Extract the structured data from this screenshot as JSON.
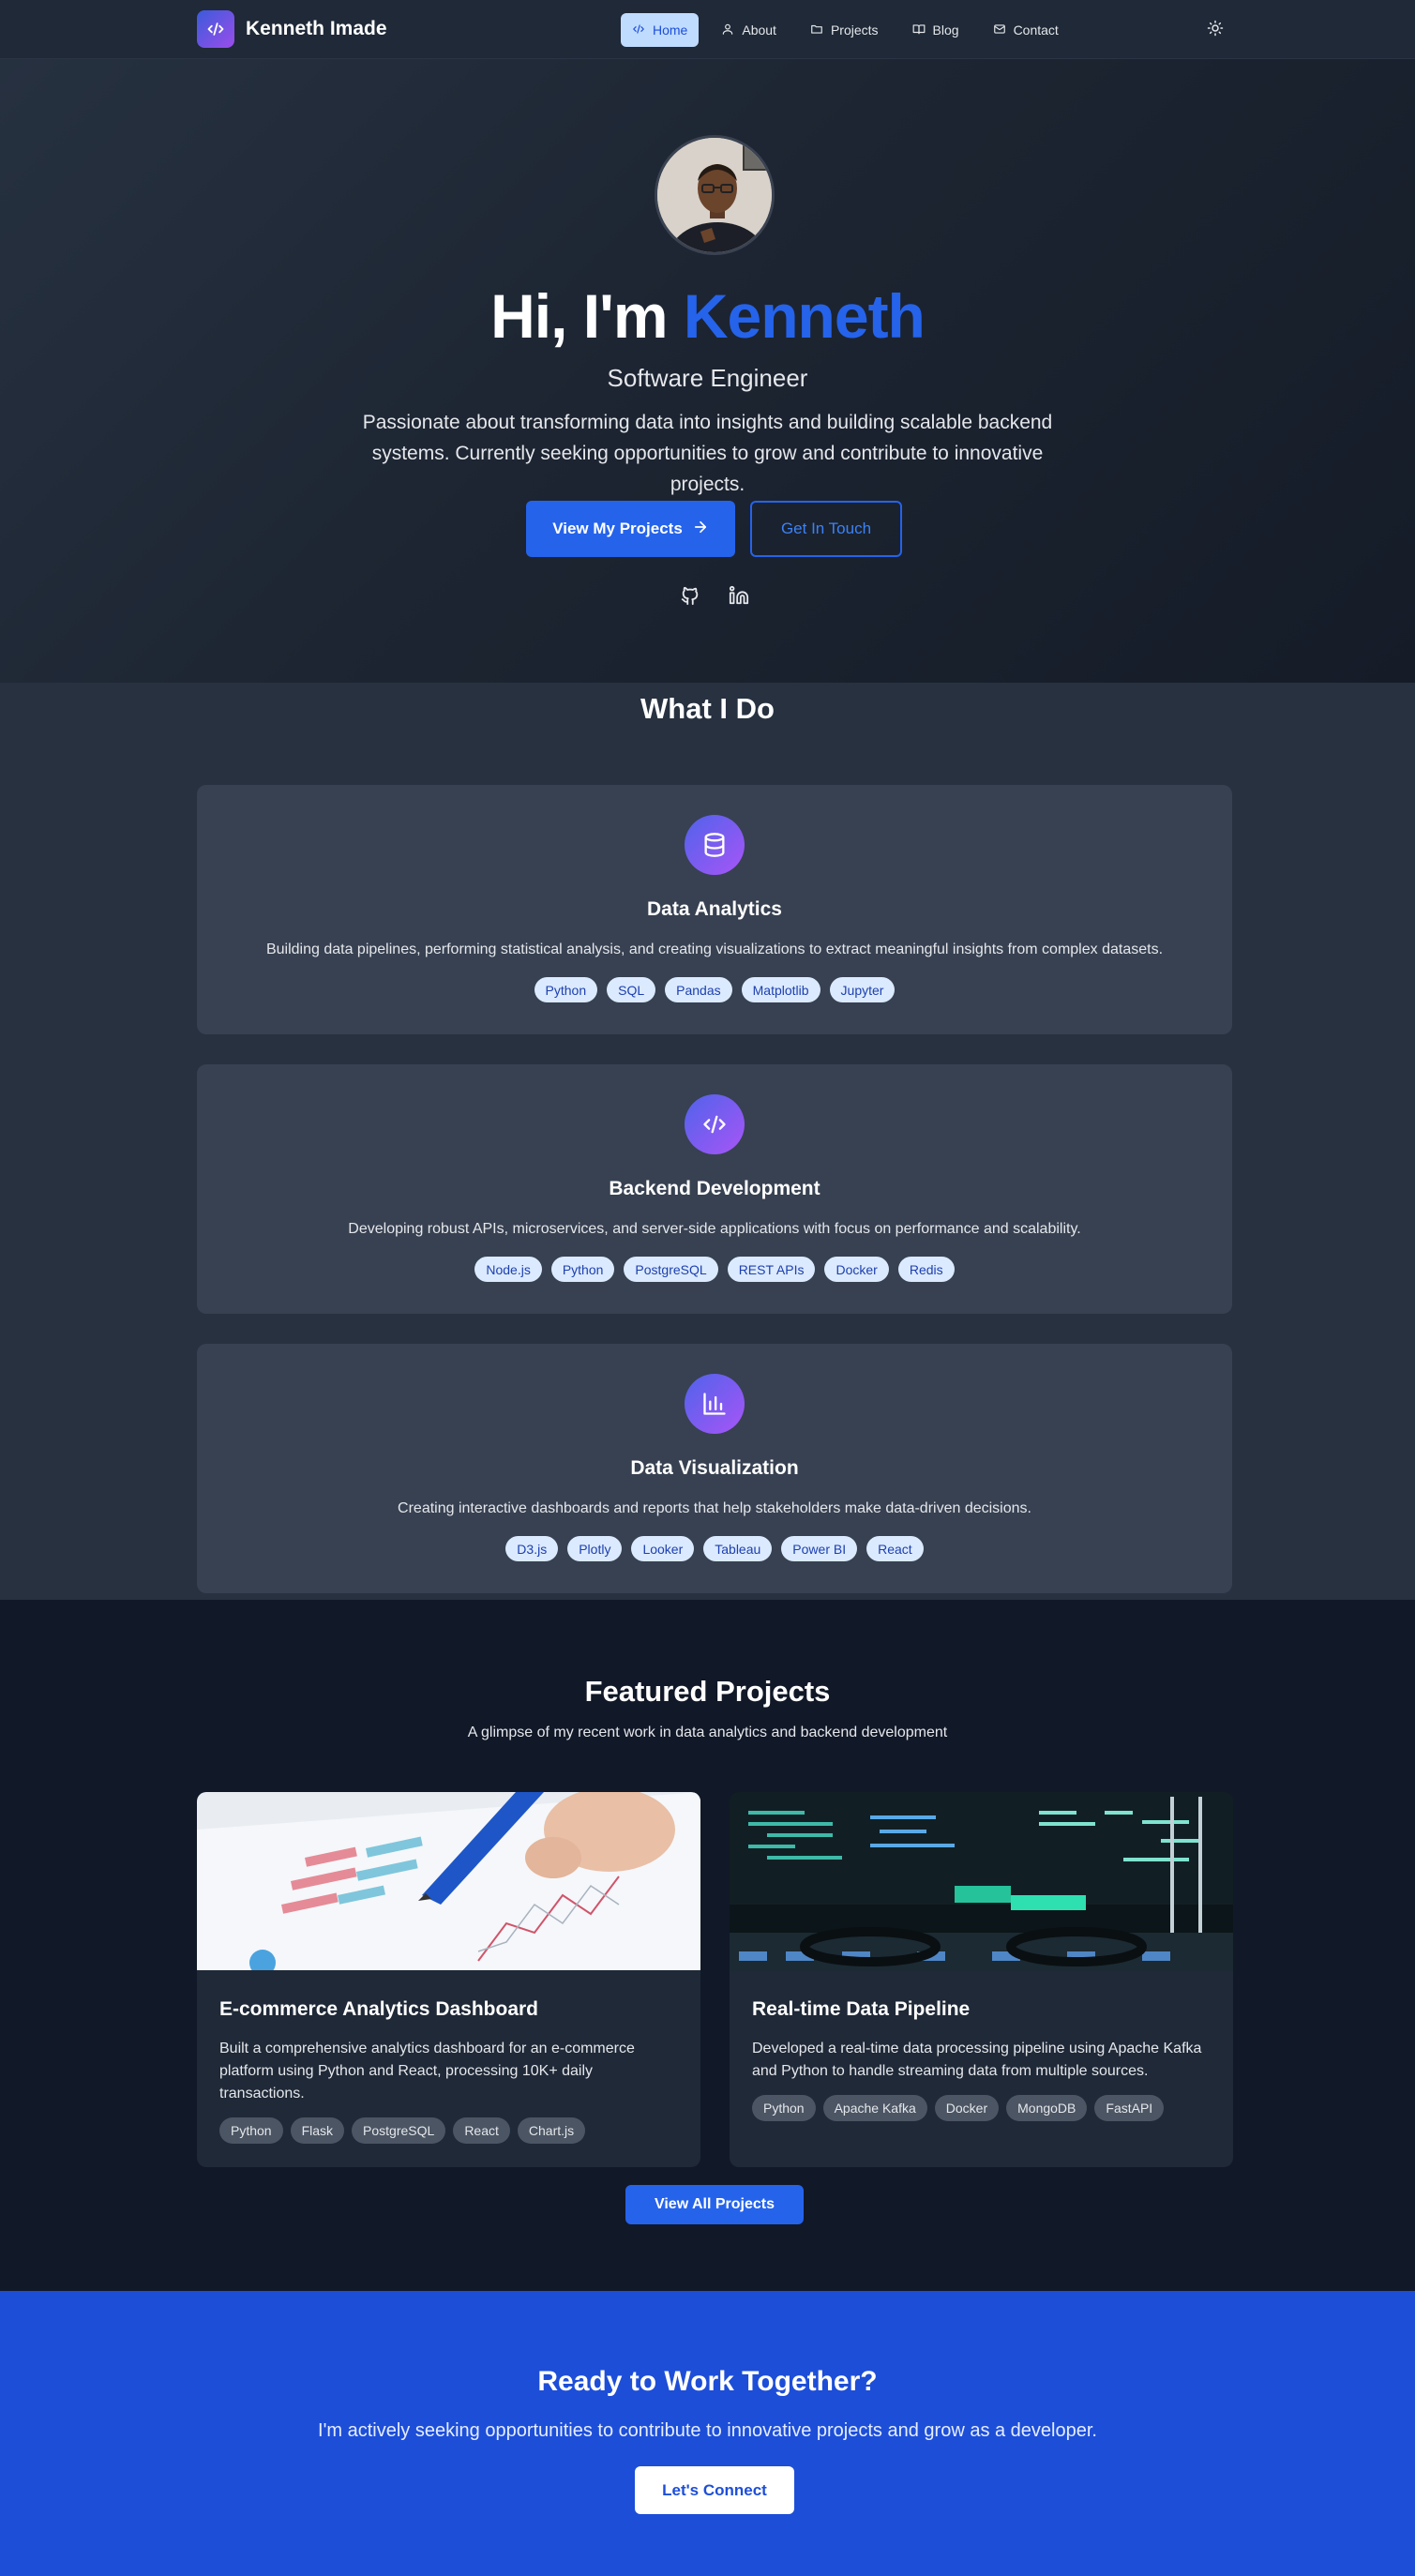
{
  "nav": {
    "brand": "Kenneth Imade",
    "items": [
      {
        "label": "Home",
        "icon": "code-icon"
      },
      {
        "label": "About",
        "icon": "user-icon"
      },
      {
        "label": "Projects",
        "icon": "folder-icon"
      },
      {
        "label": "Blog",
        "icon": "book-icon"
      },
      {
        "label": "Contact",
        "icon": "mail-icon"
      }
    ],
    "theme_icon": "sun-icon"
  },
  "hero": {
    "greeting": "Hi, I'm ",
    "name": "Kenneth",
    "role": "Software Engineer",
    "description": "Passionate about transforming data into insights and building scalable backend systems. Currently seeking opportunities to grow and contribute to innovative projects.",
    "primary_button": "View My Projects",
    "secondary_button": "Get In Touch",
    "social_icons": [
      "github-icon",
      "linkedin-icon"
    ]
  },
  "services": {
    "title": "What I Do",
    "items": [
      {
        "icon": "database-icon",
        "title": "Data Analytics",
        "description": "Building data pipelines, performing statistical analysis, and creating visualizations to extract meaningful insights from complex datasets.",
        "tags": [
          "Python",
          "SQL",
          "Pandas",
          "Matplotlib",
          "Jupyter"
        ]
      },
      {
        "icon": "code-icon",
        "title": "Backend Development",
        "description": "Developing robust APIs, microservices, and server-side applications with focus on performance and scalability.",
        "tags": [
          "Node.js",
          "Python",
          "PostgreSQL",
          "REST APIs",
          "Docker",
          "Redis"
        ]
      },
      {
        "icon": "bar-chart-icon",
        "title": "Data Visualization",
        "description": "Creating interactive dashboards and reports that help stakeholders make data-driven decisions.",
        "tags": [
          "D3.js",
          "Plotly",
          "Looker",
          "Tableau",
          "Power BI",
          "React"
        ]
      }
    ]
  },
  "projects": {
    "title": "Featured Projects",
    "subtitle": "A glimpse of my recent work in data analytics and backend development",
    "items": [
      {
        "title": "E-commerce Analytics Dashboard",
        "description": "Built a comprehensive analytics dashboard for an e-commerce platform using Python and React, processing 10K+ daily transactions.",
        "tags": [
          "Python",
          "Flask",
          "PostgreSQL",
          "React",
          "Chart.js"
        ]
      },
      {
        "title": "Real-time Data Pipeline",
        "description": "Developed a real-time data processing pipeline using Apache Kafka and Python to handle streaming data from multiple sources.",
        "tags": [
          "Python",
          "Apache Kafka",
          "Docker",
          "MongoDB",
          "FastAPI"
        ]
      }
    ],
    "view_all": "View All Projects"
  },
  "cta": {
    "title": "Ready to Work Together?",
    "subtitle": "I'm actively seeking opportunities to contribute to innovative projects and grow as a developer.",
    "button": "Let's Connect"
  },
  "colors": {
    "accent": "#2563eb",
    "nav_bg": "#1f2937",
    "card_bg": "#374151",
    "page_bg": "#111827",
    "cta_bg": "#1d4ed8",
    "tag_bg": "#dbeafe",
    "tag_text": "#1e40af"
  }
}
